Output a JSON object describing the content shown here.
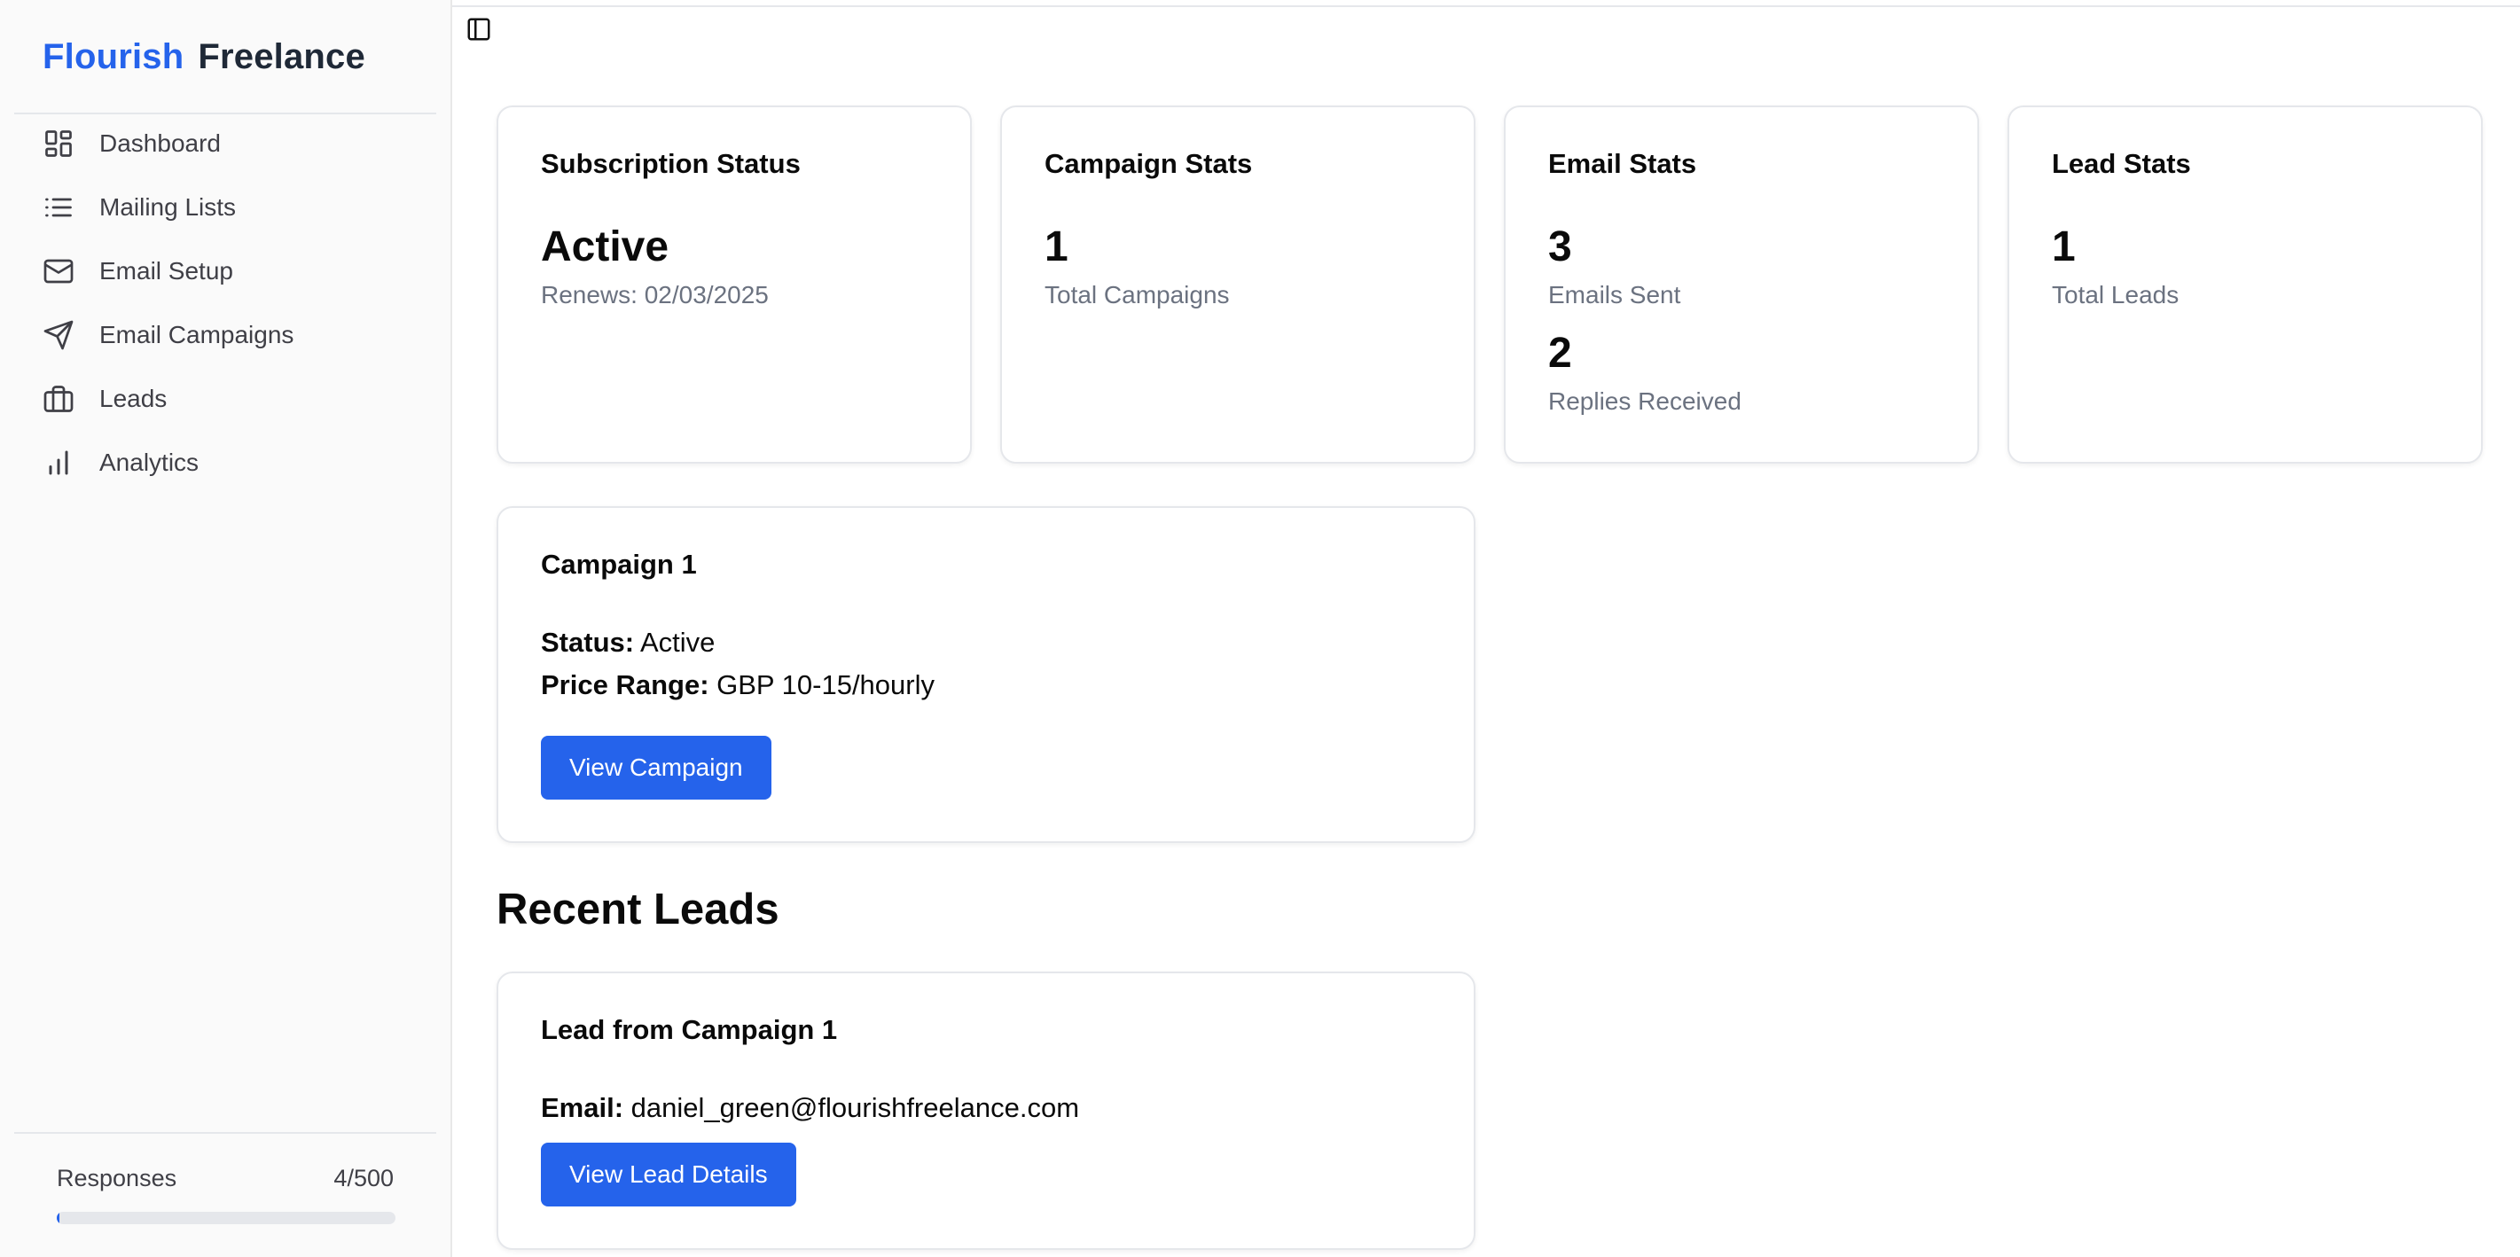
{
  "brand": {
    "part1": "Flourish",
    "part2": "Freelance"
  },
  "nav": [
    {
      "label": "Dashboard",
      "icon": "dashboard-icon"
    },
    {
      "label": "Mailing Lists",
      "icon": "list-icon"
    },
    {
      "label": "Email Setup",
      "icon": "mail-icon"
    },
    {
      "label": "Email Campaigns",
      "icon": "send-icon"
    },
    {
      "label": "Leads",
      "icon": "briefcase-icon"
    },
    {
      "label": "Analytics",
      "icon": "bar-chart-icon"
    }
  ],
  "responses": {
    "label": "Responses",
    "count": "4/500",
    "progress": 0.008
  },
  "cards": {
    "subscription": {
      "title": "Subscription Status",
      "value": "Active",
      "sub": "Renews: 02/03/2025"
    },
    "campaign": {
      "title": "Campaign Stats",
      "value": "1",
      "sub": "Total Campaigns"
    },
    "email": {
      "title": "Email Stats",
      "sent_value": "3",
      "sent_label": "Emails Sent",
      "replies_value": "2",
      "replies_label": "Replies Received"
    },
    "lead": {
      "title": "Lead Stats",
      "value": "1",
      "sub": "Total Leads"
    }
  },
  "campaign1": {
    "title": "Campaign 1",
    "status_label": "Status:",
    "status_value": "Active",
    "price_label": "Price Range:",
    "price_value": "GBP 10-15/hourly",
    "button": "View Campaign"
  },
  "recent_leads": {
    "title": "Recent Leads",
    "lead": {
      "title": "Lead from Campaign 1",
      "email_label": "Email:",
      "email_value": "daniel_green@flourishfreelance.com",
      "button": "View Lead Details"
    }
  },
  "colors": {
    "accent": "#2563eb",
    "muted": "#6b7280",
    "border": "#e5e7eb",
    "sidebar_bg": "#fafafa"
  }
}
